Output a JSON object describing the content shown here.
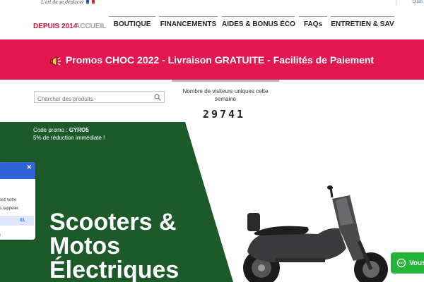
{
  "brand": {
    "slogan": "L'art de se déplacer"
  },
  "header": {
    "corner_link": "Québ"
  },
  "nav": {
    "since": "DEPUIS 2014",
    "home": "ACCUEIL",
    "items": [
      "BOUTIQUE",
      "FINANCEMENTS",
      "AIDES & BONUS ÉCO",
      "FAQs",
      "ENTRETIEN & SAV"
    ]
  },
  "banner": {
    "text": "Promos CHOC 2022 - Livraison GRATUITE - Facilités de Paiement",
    "color": "#e3174f"
  },
  "search": {
    "placeholder": "Chercher des produits"
  },
  "counter": {
    "label": "Nombre de visiteurs uniques cette semaine",
    "value": "29741"
  },
  "hero": {
    "promo_prefix": "Code promo : ",
    "promo_code": "GYRO5",
    "promo_desc": "5% de réduction immédiate !",
    "title_line1": "Scooters &",
    "title_line2": "Motos",
    "title_line3": "Électriques",
    "bg_color": "#1c5a2a"
  },
  "popup": {
    "line1": "ssez votre",
    "line2": "us rappeler.",
    "button": "EL",
    "footer": "oll"
  },
  "whatsapp": {
    "label": "Vous",
    "color": "#25b33a"
  }
}
